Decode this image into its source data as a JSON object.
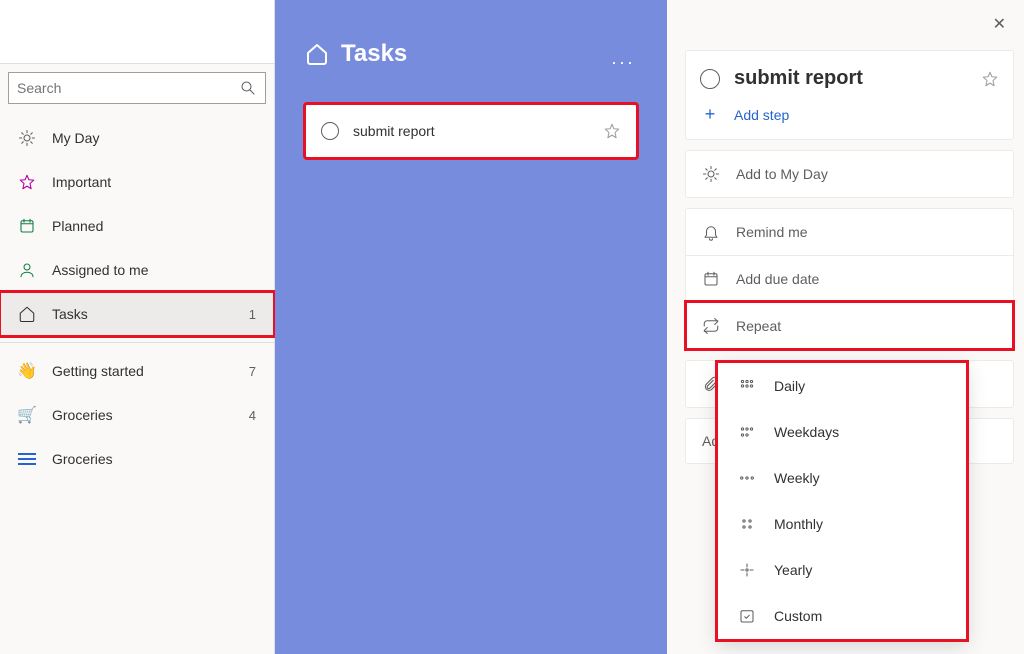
{
  "search": {
    "placeholder": "Search"
  },
  "sidebar": {
    "items": [
      {
        "label": "My Day"
      },
      {
        "label": "Important"
      },
      {
        "label": "Planned"
      },
      {
        "label": "Assigned to me"
      },
      {
        "label": "Tasks",
        "count": "1"
      }
    ],
    "lists": [
      {
        "label": "Getting started",
        "count": "7"
      },
      {
        "label": "Groceries",
        "count": "4"
      },
      {
        "label": "Groceries"
      }
    ]
  },
  "middle": {
    "title": "Tasks",
    "task": {
      "label": "submit report"
    }
  },
  "detail": {
    "title": "submit report",
    "add_step": "Add step",
    "add_my_day": "Add to My Day",
    "remind": "Remind me",
    "due": "Add due date",
    "repeat": "Repeat",
    "note": "Add",
    "repeat_options": [
      "Daily",
      "Weekdays",
      "Weekly",
      "Monthly",
      "Yearly",
      "Custom"
    ]
  }
}
